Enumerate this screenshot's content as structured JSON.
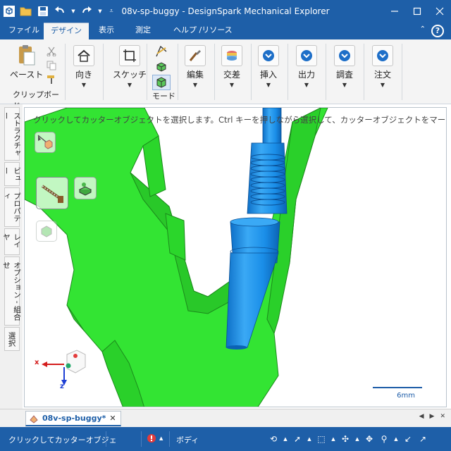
{
  "window": {
    "title": "08v-sp-buggy - DesignSpark Mechanical Explorer"
  },
  "tabs": [
    {
      "label": "ファイル"
    },
    {
      "label": "デザイン"
    },
    {
      "label": "表示"
    },
    {
      "label": "測定"
    },
    {
      "label": "ヘルプ /リソース"
    }
  ],
  "ribbon": {
    "paste": "ペースト",
    "clipboard": "クリップボード",
    "orient": "向き",
    "sketch": "スケッチ",
    "mode": "モード",
    "edit": "編集",
    "intersect": "交差",
    "insert": "挿入",
    "output": "出力",
    "investigate": "調査",
    "order": "注文"
  },
  "sidepanel": {
    "tabs": [
      {
        "label": "ストラクチャー"
      },
      {
        "label": "ビュー"
      },
      {
        "label": "プロパティ"
      },
      {
        "label": "レイヤ"
      },
      {
        "label": "オプション - 組合せ"
      },
      {
        "label": "選択"
      }
    ]
  },
  "viewport": {
    "hint": "クリックしてカッターオブジェクトを選択します。Ctrl キーを押しながら選択して、カッターオブジェクトをマージ",
    "triad": {
      "x": "x",
      "z": "z"
    },
    "scale": "6mm"
  },
  "document": {
    "tab": "08v-sp-buggy*"
  },
  "status": {
    "message": "クリックしてカッターオブジェ",
    "selection": "ボディ"
  },
  "colors": {
    "chrome": "#1e5fa8",
    "part": "#33e433",
    "tool": "#1a8ee8"
  }
}
